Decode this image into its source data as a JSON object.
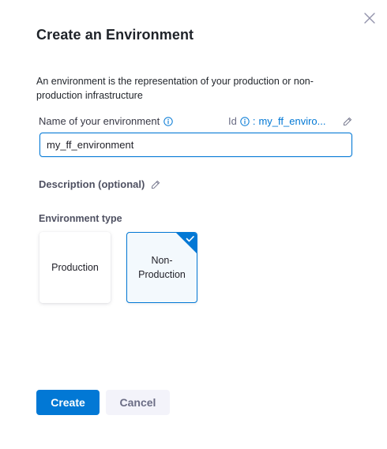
{
  "dialog": {
    "title": "Create an Environment",
    "intro": "An environment is the representation of your production or non-production infrastructure"
  },
  "form": {
    "name_label": "Name of your environment",
    "id_label": "Id",
    "id_separator": ":",
    "id_value": "my_ff_enviro...",
    "name_value": "my_ff_environment",
    "description_label": "Description (optional)",
    "env_type_label": "Environment type",
    "env_types": [
      {
        "label": "Production",
        "selected": false
      },
      {
        "label": "Non-Production",
        "selected": true
      }
    ]
  },
  "footer": {
    "create_label": "Create",
    "cancel_label": "Cancel"
  },
  "colors": {
    "accent": "#0278d5",
    "selected_card_bg": "#f3f9fd",
    "cancel_bg": "#f3f3fa"
  },
  "icons": {
    "close": "close-icon",
    "info": "info-icon",
    "edit": "pencil-icon",
    "check": "checkmark-icon"
  }
}
